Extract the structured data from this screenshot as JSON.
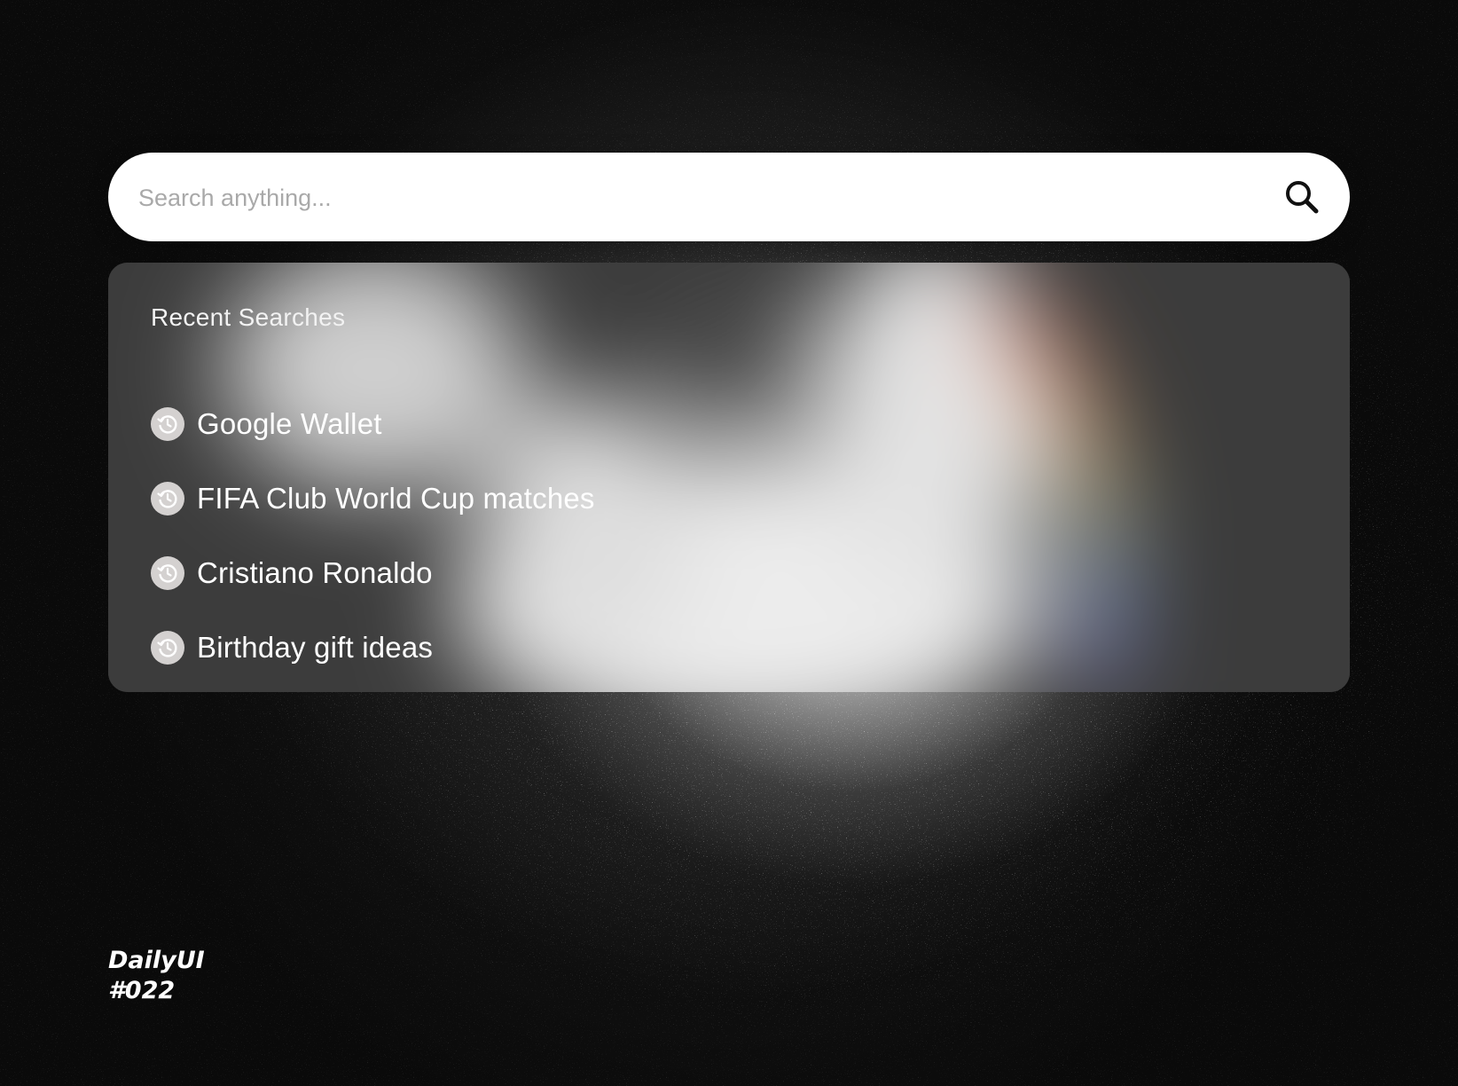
{
  "search": {
    "placeholder": "Search anything...",
    "value": ""
  },
  "recent": {
    "title": "Recent Searches",
    "items": [
      {
        "label": "Google Wallet",
        "icon": "history-icon"
      },
      {
        "label": "FIFA Club World Cup matches",
        "icon": "history-icon"
      },
      {
        "label": "Cristiano Ronaldo",
        "icon": "history-icon"
      },
      {
        "label": "Birthday gift ideas",
        "icon": "history-icon"
      }
    ]
  },
  "brand": {
    "line1": "DailyUI",
    "line2": "#022"
  },
  "colors": {
    "background": "#0b0b0b",
    "search_bar": "#ffffff",
    "dropdown": "#3b3b3b",
    "history_icon_bg": "#d4d1d0",
    "text_primary": "#ffffff",
    "placeholder": "#a9a9a9"
  }
}
